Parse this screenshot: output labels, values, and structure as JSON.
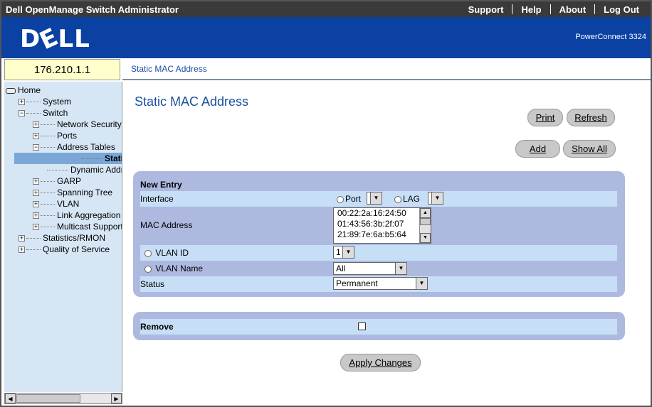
{
  "app": {
    "window_title": "Dell OpenManage Switch Administrator",
    "top_links": [
      "Support",
      "Help",
      "About",
      "Log Out"
    ],
    "logo_text": "DELL",
    "product": "PowerConnect 3324"
  },
  "device": {
    "ip": "176.210.1.1"
  },
  "breadcrumb": "Static MAC Address",
  "sidebar": {
    "items": [
      {
        "label": "Home",
        "level": 0,
        "expander": "",
        "icon": "home-icon"
      },
      {
        "label": "System",
        "level": 1,
        "expander": "+"
      },
      {
        "label": "Switch",
        "level": 1,
        "expander": "-"
      },
      {
        "label": "Network Security",
        "level": 2,
        "expander": "+"
      },
      {
        "label": "Ports",
        "level": 2,
        "expander": "+"
      },
      {
        "label": "Address Tables",
        "level": 2,
        "expander": "-"
      },
      {
        "label": "Static Address",
        "level": 3,
        "expander": "",
        "selected": true
      },
      {
        "label": "Dynamic Address",
        "level": 3,
        "expander": ""
      },
      {
        "label": "GARP",
        "level": 2,
        "expander": "+"
      },
      {
        "label": "Spanning Tree",
        "level": 2,
        "expander": "+"
      },
      {
        "label": "VLAN",
        "level": 2,
        "expander": "+"
      },
      {
        "label": "Link Aggregation",
        "level": 2,
        "expander": "+"
      },
      {
        "label": "Multicast Support",
        "level": 2,
        "expander": "+"
      },
      {
        "label": "Statistics/RMON",
        "level": 1,
        "expander": "+"
      },
      {
        "label": "Quality of Service",
        "level": 1,
        "expander": "+"
      }
    ]
  },
  "main": {
    "title": "Static MAC Address",
    "buttons": {
      "print": "Print",
      "refresh": "Refresh",
      "add": "Add",
      "show_all": "Show All",
      "apply": "Apply Changes"
    },
    "new_entry": {
      "header": "New Entry",
      "interface_label": "Interface",
      "port_label": "Port",
      "lag_label": "LAG",
      "mac_label": "MAC Address",
      "mac_list": [
        "00:22:2a:16:24:50",
        "01:43:56:3b:2f:07",
        "21:89:7e:6a:b5:64"
      ],
      "vlan_id_label": "VLAN ID",
      "vlan_id_value": "1",
      "vlan_name_label": "VLAN Name",
      "vlan_name_value": "All",
      "status_label": "Status",
      "status_value": "Permanent"
    },
    "remove": {
      "label": "Remove",
      "checked": false
    }
  }
}
